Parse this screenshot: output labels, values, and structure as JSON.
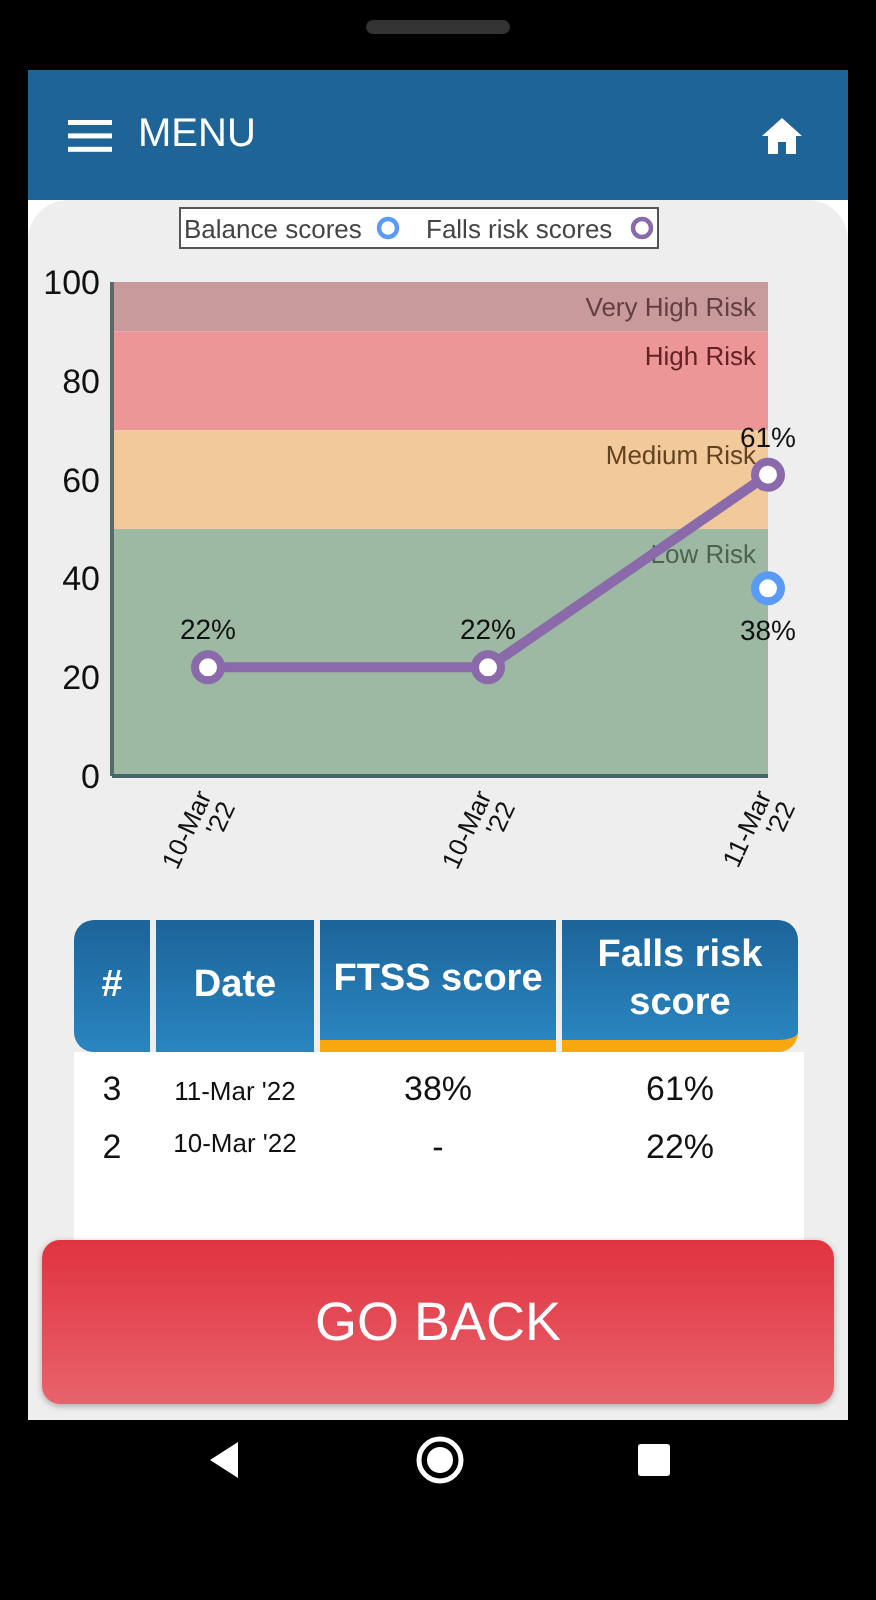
{
  "app_bar": {
    "menu_label": "MENU"
  },
  "chart_data": {
    "type": "line",
    "categories": [
      "10-Mar '22",
      "10-Mar '22",
      "11-Mar '22"
    ],
    "ylim": [
      0,
      100
    ],
    "yticks": [
      0,
      20,
      40,
      60,
      80,
      100
    ],
    "legend": "top",
    "series": [
      {
        "name": "Balance scores",
        "color": "#5b9bf8",
        "marker": "o",
        "values": [
          null,
          null,
          38
        ]
      },
      {
        "name": "Falls risk scores",
        "color": "#8a6aaa",
        "marker": "o",
        "values": [
          22,
          22,
          61
        ]
      }
    ],
    "value_labels": [
      [
        null,
        null,
        "38%"
      ],
      [
        "22%",
        "22%",
        "61%"
      ]
    ],
    "bands": [
      {
        "label": "Very High Risk",
        "axis": "y",
        "from": 90,
        "to": 100,
        "color": "#c99a9b"
      },
      {
        "label": "High Risk",
        "axis": "y",
        "from": 70,
        "to": 90,
        "color": "#ec9697"
      },
      {
        "label": "Medium Risk",
        "axis": "y",
        "from": 50,
        "to": 70,
        "color": "#f2c99b"
      },
      {
        "label": "Low Risk",
        "axis": "y",
        "from": 0,
        "to": 50,
        "color": "#9db9a3"
      }
    ]
  },
  "table": {
    "columns": [
      {
        "label": "#",
        "underlined": false
      },
      {
        "label": "Date",
        "underlined": false
      },
      {
        "label": "FTSS score",
        "underlined": true
      },
      {
        "label": "Falls risk score",
        "underlined": true
      }
    ],
    "rows": [
      [
        "3",
        "11-Mar '22",
        "38%",
        "61%"
      ],
      [
        "2",
        "10-Mar '22",
        "-",
        "22%"
      ]
    ]
  },
  "button": {
    "label": "GO BACK"
  }
}
